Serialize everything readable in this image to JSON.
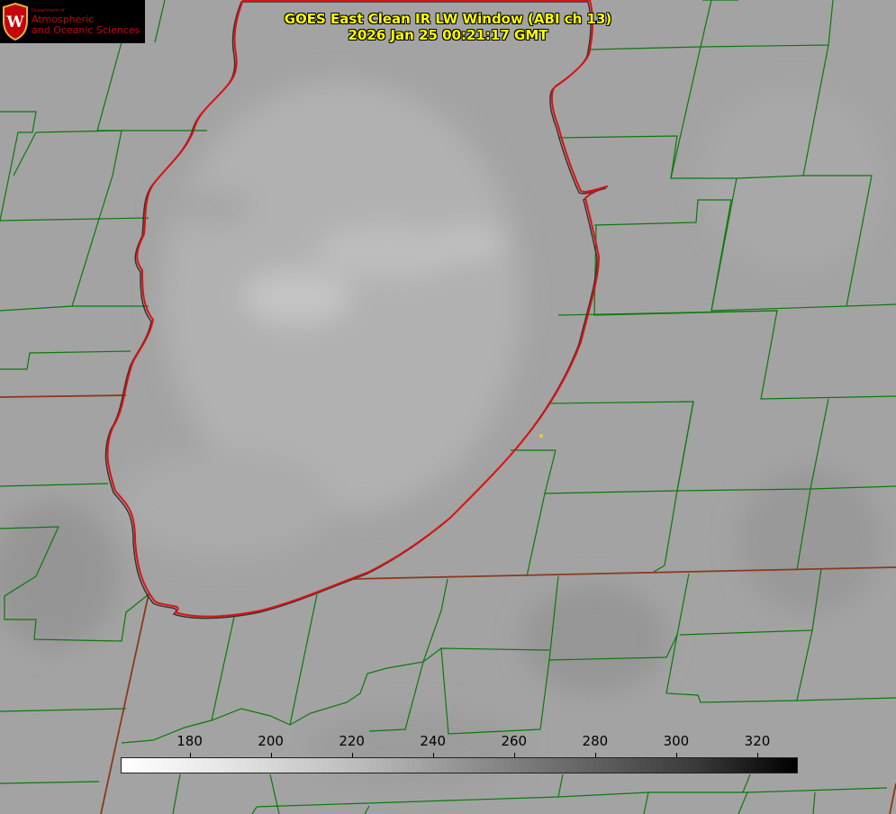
{
  "title": {
    "line1": "GOES East Clean IR LW Window (ABI ch 13)",
    "line2": "2026 Jan 25 00:21:17 GMT"
  },
  "logo": {
    "dept": "Department of",
    "name_line1": "Atmospheric",
    "name_line2": "and Oceanic Sciences",
    "icon": "uw-crest-icon",
    "letter": "W"
  },
  "colorbar": {
    "ticks": [
      "180",
      "200",
      "220",
      "240",
      "260",
      "280",
      "300",
      "320"
    ],
    "values": [
      180,
      200,
      220,
      240,
      260,
      280,
      300,
      320
    ],
    "range": [
      163,
      330
    ],
    "colors": {
      "low": "#ffffff",
      "high": "#000000"
    }
  },
  "colors": {
    "lake_outline": "#e01010",
    "county_lines": "#0a7a0a",
    "state_lines": "#8b3a1a",
    "title_text": "#ffff00",
    "marker": "#e8d21a"
  }
}
